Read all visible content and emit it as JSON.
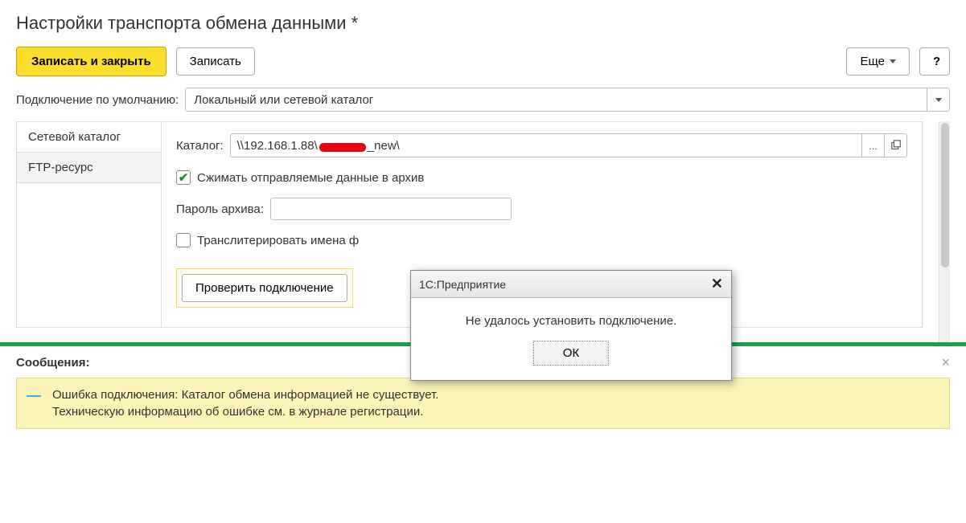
{
  "header": {
    "title": "Настройки транспорта обмена данными *"
  },
  "toolbar": {
    "save_close": "Записать и закрыть",
    "save": "Записать",
    "more": "Еще",
    "help": "?"
  },
  "default_conn": {
    "label": "Подключение по умолчанию:",
    "value": "Локальный или сетевой каталог"
  },
  "tabs": {
    "network": "Сетевой каталог",
    "ftp": "FTP-ресурс"
  },
  "catalog": {
    "label": "Каталог:",
    "value_prefix": "\\\\192.168.1.88\\",
    "value_suffix": "_new\\",
    "browse": "...",
    "open": "open"
  },
  "compress": {
    "checked": true,
    "label": "Сжимать отправляемые данные в архив"
  },
  "archive_pw": {
    "label": "Пароль архива:",
    "value": ""
  },
  "transliterate": {
    "checked": false,
    "label": "Транслитерировать имена ф"
  },
  "test_btn": "Проверить подключение",
  "dialog": {
    "title": "1С:Предприятие",
    "message": "Не удалось установить подключение.",
    "ok": "ОК"
  },
  "messages": {
    "title": "Сообщения",
    "line1": "Ошибка подключения: Каталог обмена информацией не существует.",
    "line2": "Техническую информацию об ошибке см. в журнале регистрации."
  }
}
